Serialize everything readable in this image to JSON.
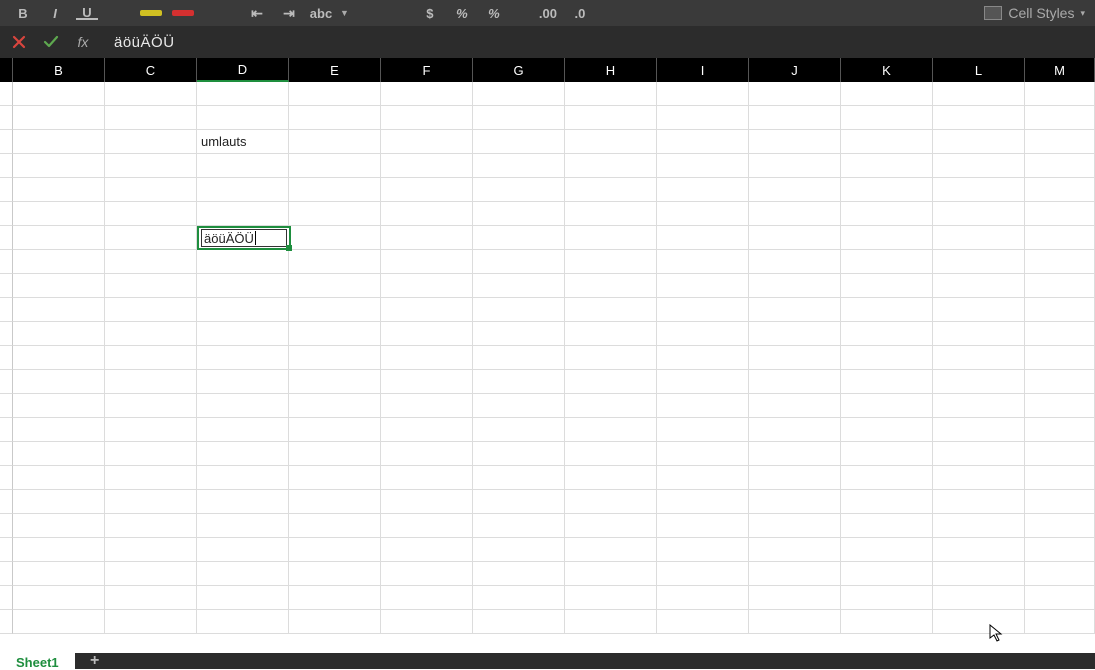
{
  "toolbar": {
    "bold_label": "B",
    "italic_label": "I",
    "underline_label": "U",
    "abc_label": "abc",
    "currency_label": "$",
    "percent_left": "%",
    "percent_right": "%",
    "decimal_a": ".00",
    "decimal_b": ".0",
    "cell_styles_label": "Cell Styles"
  },
  "formula_bar": {
    "fx_label": "fx",
    "value": "äöüÄÖÜ"
  },
  "columns": [
    "B",
    "C",
    "D",
    "E",
    "F",
    "G",
    "H",
    "I",
    "J",
    "K",
    "L",
    "M"
  ],
  "active_column": "D",
  "cells": {
    "D_heading": "umlauts",
    "D_editing": "äöüÄÖÜ"
  },
  "rows_count": 23,
  "sheet": {
    "active_name": "Sheet1",
    "add_label": "+"
  }
}
